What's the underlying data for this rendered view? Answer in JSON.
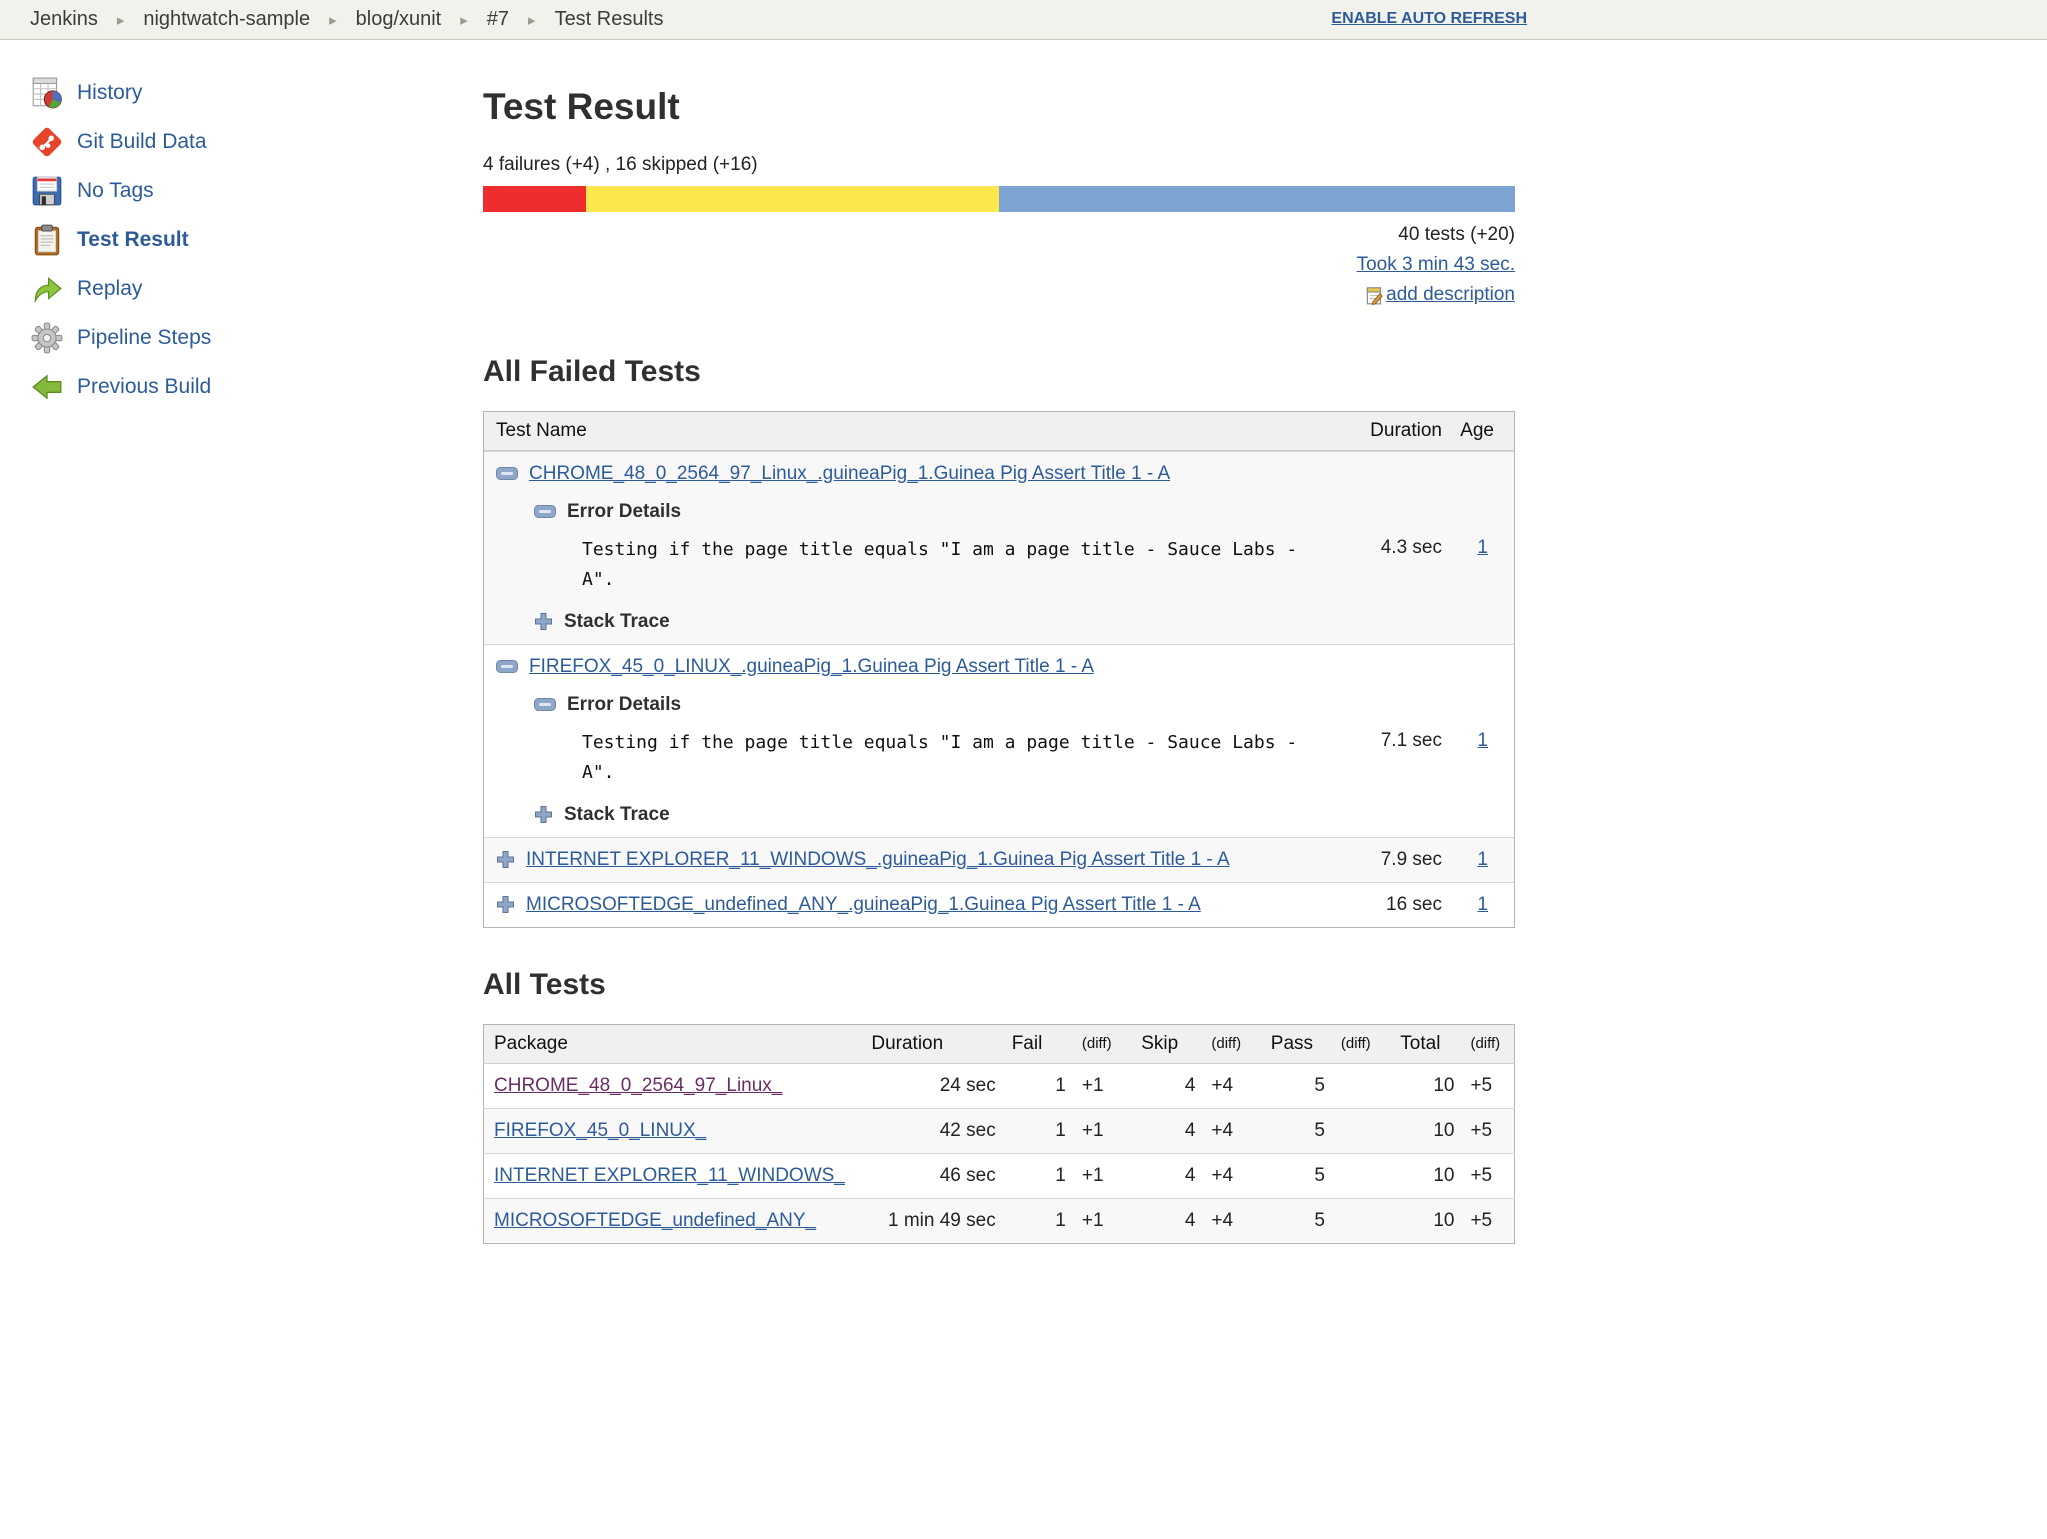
{
  "breadcrumb": {
    "items": [
      "Jenkins",
      "nightwatch-sample",
      "blog/xunit",
      "#7",
      "Test Results"
    ],
    "auto_refresh_label": "ENABLE AUTO REFRESH"
  },
  "sidebar": {
    "items": [
      {
        "label": "History",
        "icon": "history-icon"
      },
      {
        "label": "Git Build Data",
        "icon": "git-icon"
      },
      {
        "label": "No Tags",
        "icon": "floppy-icon"
      },
      {
        "label": "Test Result",
        "icon": "clipboard-icon",
        "active": true
      },
      {
        "label": "Replay",
        "icon": "replay-icon"
      },
      {
        "label": "Pipeline Steps",
        "icon": "gear-icon"
      },
      {
        "label": "Previous Build",
        "icon": "previous-build-arrow-icon"
      }
    ]
  },
  "header": {
    "title": "Test Result",
    "summary": "4 failures (+4) , 16 skipped (+16)",
    "tests_count": "40 tests (+20)",
    "took_link": "Took 3 min 43 sec.",
    "add_description_link": "add description",
    "bar": {
      "segments": [
        {
          "name": "failed",
          "pct": 10,
          "color": "#ee2e2e"
        },
        {
          "name": "skipped",
          "pct": 40,
          "color": "#fce74e"
        },
        {
          "name": "passed",
          "pct": 50,
          "color": "#7ca3d2"
        }
      ]
    }
  },
  "failed_tests": {
    "heading": "All Failed Tests",
    "col_test_name": "Test Name",
    "col_duration": "Duration",
    "col_age": "Age",
    "error_details_label": "Error Details",
    "stack_trace_label": "Stack Trace",
    "rows": [
      {
        "name": "CHROME_48_0_2564_97_Linux_.guineaPig_1.Guinea Pig Assert Title 1 - A",
        "expanded": true,
        "error_text": "Testing if the page title equals \"I am a page title - Sauce Labs - A\".",
        "duration": "4.3 sec",
        "age": "1"
      },
      {
        "name": "FIREFOX_45_0_LINUX_.guineaPig_1.Guinea Pig Assert Title 1 - A",
        "expanded": true,
        "error_text": "Testing if the page title equals \"I am a page title - Sauce Labs - A\".",
        "duration": "7.1 sec",
        "age": "1"
      },
      {
        "name": "INTERNET EXPLORER_11_WINDOWS_.guineaPig_1.Guinea Pig Assert Title 1 - A",
        "expanded": false,
        "duration": "7.9 sec",
        "age": "1"
      },
      {
        "name": "MICROSOFTEDGE_undefined_ANY_.guineaPig_1.Guinea Pig Assert Title 1 - A",
        "expanded": false,
        "duration": "16 sec",
        "age": "1"
      }
    ]
  },
  "all_tests": {
    "heading": "All Tests",
    "columns": {
      "package": "Package",
      "duration": "Duration",
      "fail": "Fail",
      "diff": "(diff)",
      "skip": "Skip",
      "pass": "Pass",
      "total": "Total"
    },
    "rows": [
      {
        "package": "CHROME_48_0_2564_97_Linux_",
        "visited": true,
        "duration": "24 sec",
        "fail": "1",
        "fail_diff": "+1",
        "skip": "4",
        "skip_diff": "+4",
        "pass": "5",
        "pass_diff": "",
        "total": "10",
        "total_diff": "+5"
      },
      {
        "package": "FIREFOX_45_0_LINUX_",
        "visited": false,
        "duration": "42 sec",
        "fail": "1",
        "fail_diff": "+1",
        "skip": "4",
        "skip_diff": "+4",
        "pass": "5",
        "pass_diff": "",
        "total": "10",
        "total_diff": "+5"
      },
      {
        "package": "INTERNET EXPLORER_11_WINDOWS_",
        "visited": false,
        "duration": "46 sec",
        "fail": "1",
        "fail_diff": "+1",
        "skip": "4",
        "skip_diff": "+4",
        "pass": "5",
        "pass_diff": "",
        "total": "10",
        "total_diff": "+5"
      },
      {
        "package": "MICROSOFTEDGE_undefined_ANY_",
        "visited": false,
        "duration": "1 min 49 sec",
        "fail": "1",
        "fail_diff": "+1",
        "skip": "4",
        "skip_diff": "+4",
        "pass": "5",
        "pass_diff": "",
        "total": "10",
        "total_diff": "+5"
      }
    ]
  }
}
